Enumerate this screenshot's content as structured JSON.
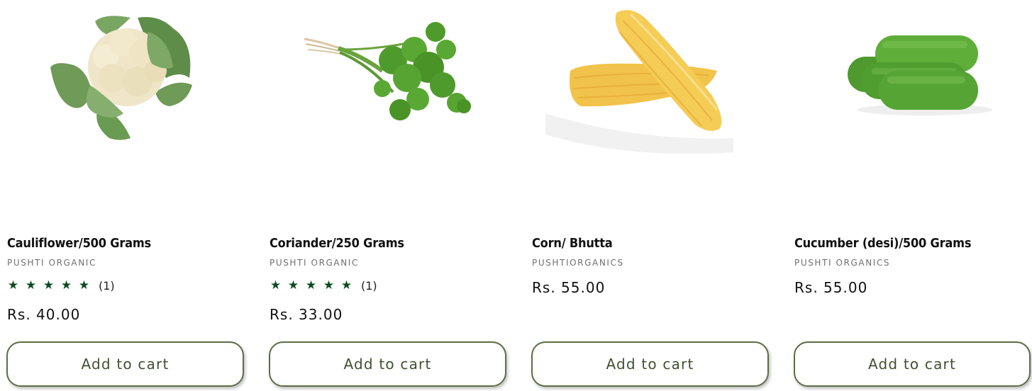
{
  "products": [
    {
      "title": "Cauliflower/500 Grams",
      "vendor": "PUSHTI ORGANIC",
      "rating_value": 5,
      "rating_count": "(1)",
      "price": "Rs. 40.00",
      "button_label": "Add to cart",
      "image": "cauliflower"
    },
    {
      "title": "Coriander/250 Grams",
      "vendor": "PUSHTI ORGANIC",
      "rating_value": 5,
      "rating_count": "(1)",
      "price": "Rs. 33.00",
      "button_label": "Add to cart",
      "image": "coriander"
    },
    {
      "title": "Corn/ Bhutta",
      "vendor": "PUSHTIORGANICS",
      "price": "Rs. 55.00",
      "button_label": "Add to cart",
      "image": "corn"
    },
    {
      "title": "Cucumber (desi)/500 Grams",
      "vendor": "PUSHTI ORGANICS",
      "price": "Rs. 55.00",
      "button_label": "Add to cart",
      "image": "cucumber"
    }
  ],
  "star_glyph": "★",
  "colors": {
    "star": "#0f4b21",
    "button_border": "#5b6e45",
    "button_text": "#3f5030"
  }
}
